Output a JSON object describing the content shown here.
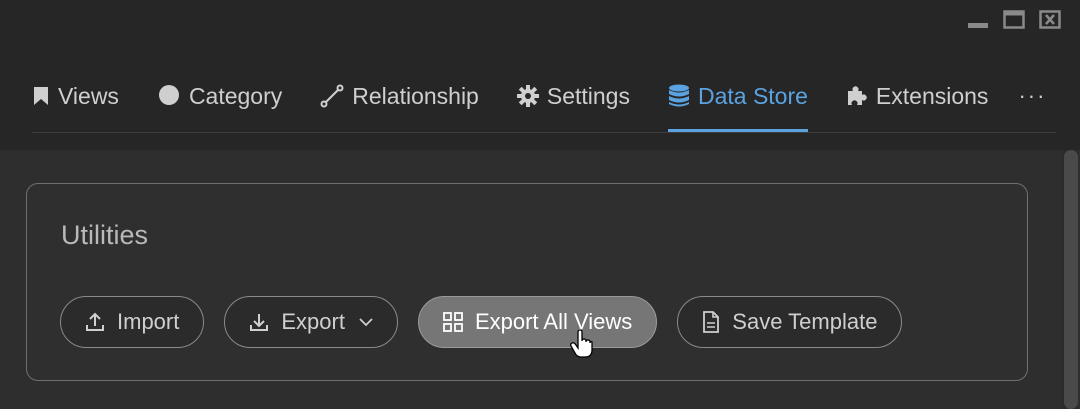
{
  "window_controls": [
    {
      "name": "minimize-icon"
    },
    {
      "name": "maximize-icon"
    },
    {
      "name": "close-icon"
    }
  ],
  "tabs": [
    {
      "label": "Views",
      "icon": "bookmark-icon",
      "active": false
    },
    {
      "label": "Category",
      "icon": "circle-icon",
      "active": false
    },
    {
      "label": "Relationship",
      "icon": "link-line-icon",
      "active": false
    },
    {
      "label": "Settings",
      "icon": "gear-icon",
      "active": false
    },
    {
      "label": "Data Store",
      "icon": "database-icon",
      "active": true
    },
    {
      "label": "Extensions",
      "icon": "puzzle-icon",
      "active": false
    }
  ],
  "more_label": "···",
  "panel": {
    "title": "Utilities",
    "buttons": [
      {
        "label": "Import",
        "icon": "upload-icon"
      },
      {
        "label": "Export",
        "icon": "download-icon",
        "has_dropdown": true
      },
      {
        "label": "Export All Views",
        "icon": "grid-icon",
        "hovered": true
      },
      {
        "label": "Save Template",
        "icon": "document-icon"
      }
    ]
  },
  "colors": {
    "accent": "#5aa3e0",
    "background": "#2b2b2b",
    "text": "#cfcfcf",
    "hover_button": "#767676"
  }
}
